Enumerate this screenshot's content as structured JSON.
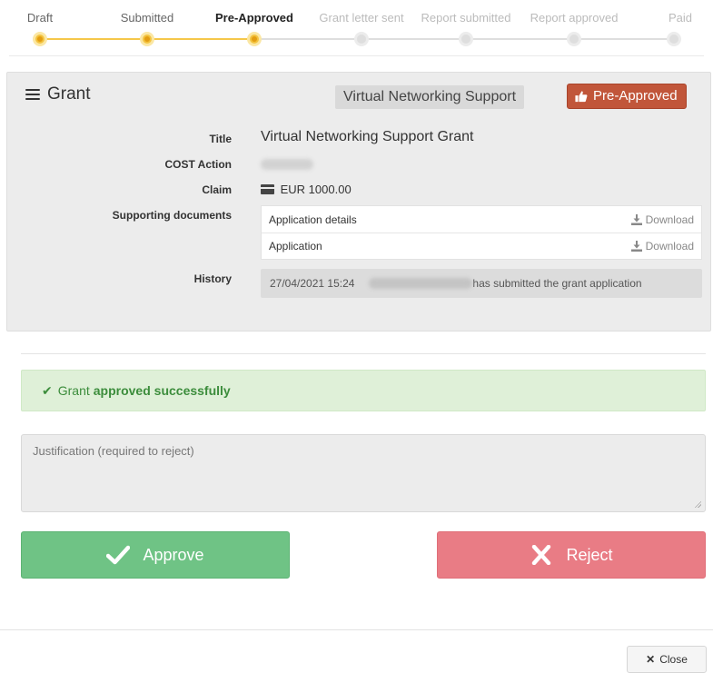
{
  "stepper": {
    "steps": [
      {
        "label": "Draft",
        "state": "done"
      },
      {
        "label": "Submitted",
        "state": "done"
      },
      {
        "label": "Pre-Approved",
        "state": "current"
      },
      {
        "label": "Grant letter sent",
        "state": "todo"
      },
      {
        "label": "Report submitted",
        "state": "todo"
      },
      {
        "label": "Report approved",
        "state": "todo"
      },
      {
        "label": "Paid",
        "state": "todo"
      }
    ],
    "colors": {
      "done": "#f3c33f",
      "todo": "#dedede"
    }
  },
  "panel": {
    "title": "Grant",
    "title_icon": "hamburger-menu-icon",
    "type_badge": "Virtual Networking Support",
    "status_badge": "Pre-Approved",
    "status_icon": "thumbs-up-icon",
    "status_color": "#c1563a"
  },
  "details": {
    "title_label": "Title",
    "title_value": "Virtual Networking Support Grant",
    "action_label": "COST Action",
    "claim_label": "Claim",
    "claim_icon": "credit-card-icon",
    "claim_value": "EUR 1000.00",
    "documents_label": "Supporting documents",
    "documents": [
      {
        "name": "Application details",
        "action": "Download"
      },
      {
        "name": "Application",
        "action": "Download"
      }
    ],
    "history_label": "History",
    "history": {
      "timestamp": "27/04/2021 15:24",
      "message": "has submitted the grant application"
    }
  },
  "alert": {
    "prefix": "Grant",
    "emphasis": "approved successfully",
    "color": "#dff0d8"
  },
  "justification": {
    "placeholder": "Justification (required to reject)"
  },
  "actions": {
    "approve_label": "Approve",
    "approve_color": "#6fc385",
    "reject_label": "Reject",
    "reject_color": "#e97c85",
    "close_label": "Close"
  }
}
